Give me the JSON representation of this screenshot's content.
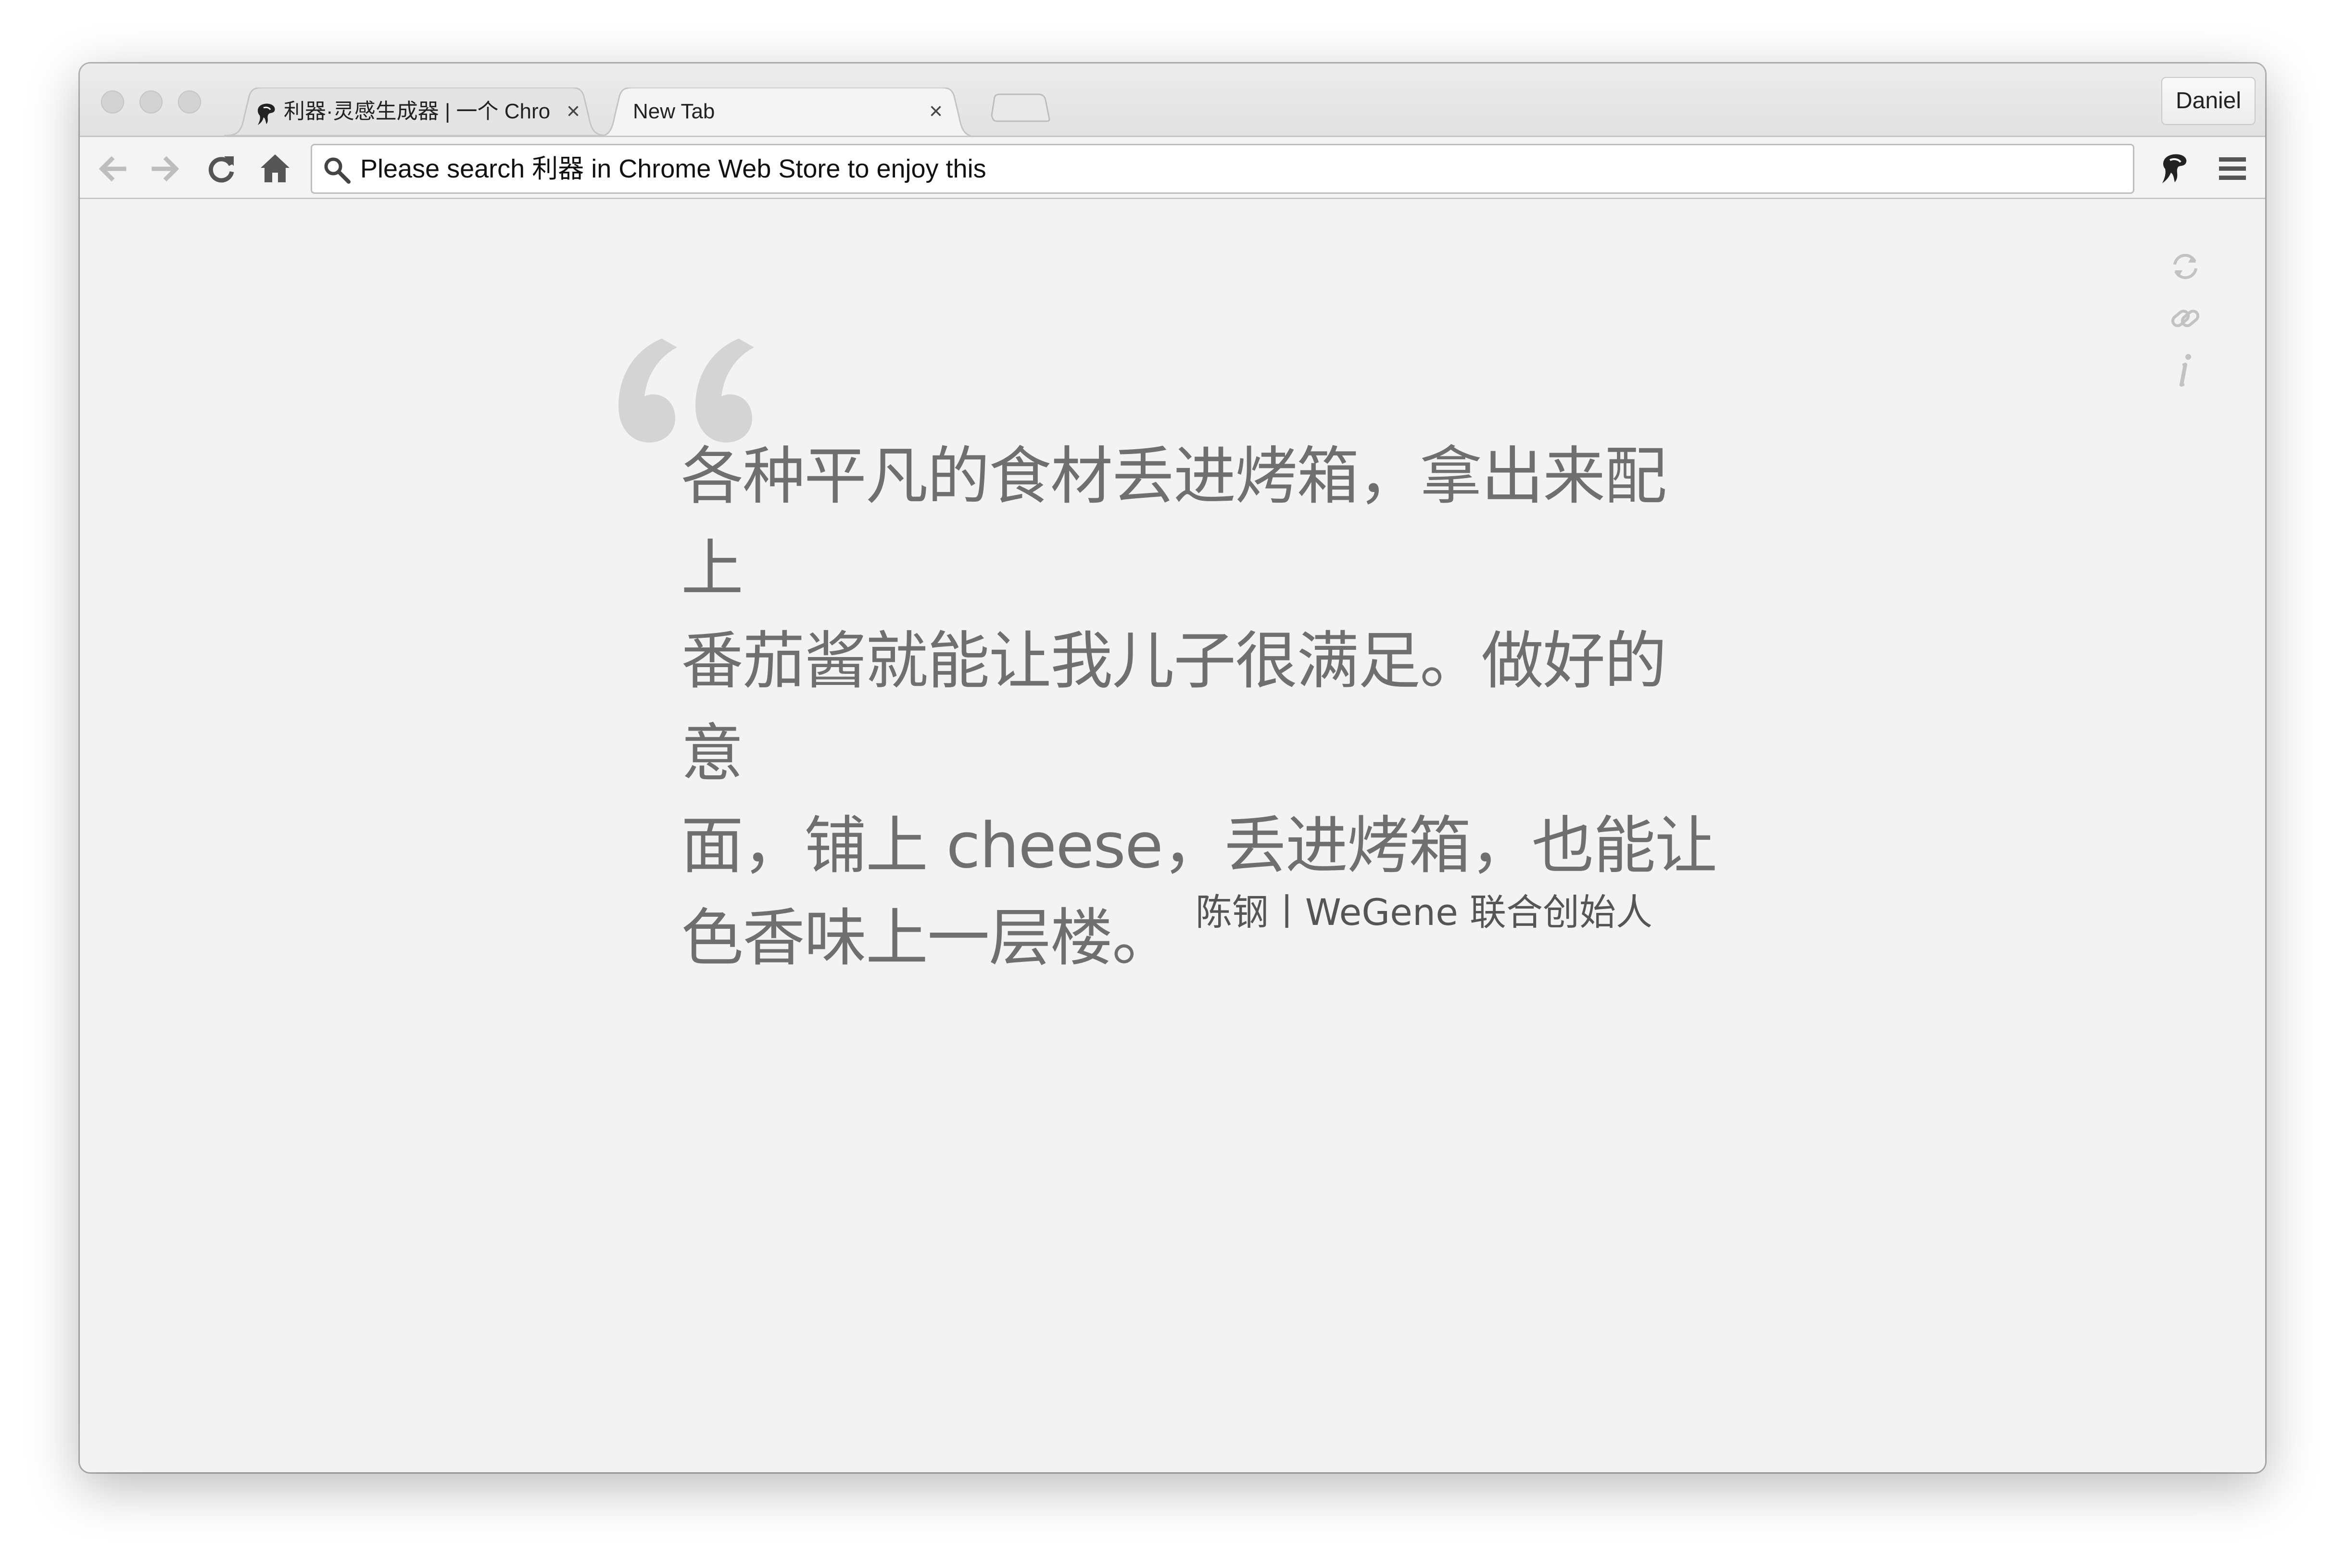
{
  "window": {
    "traffic_lights": [
      "close",
      "minimize",
      "zoom"
    ]
  },
  "tabs": [
    {
      "title": "利器·灵感生成器 | 一个 Chro",
      "icon": "jellyfish-favicon",
      "active": false
    },
    {
      "title": "New Tab",
      "icon": "",
      "active": true
    }
  ],
  "profile": {
    "name": "Daniel"
  },
  "toolbar": {
    "back": "back-arrow-icon",
    "forward": "forward-arrow-icon",
    "reload": "reload-icon",
    "home": "home-icon",
    "extension": "jellyfish-extension-icon",
    "menu": "hamburger-menu-icon"
  },
  "omnibox": {
    "text": "Please search 利器 in Chrome Web Store to enjoy this",
    "icon": "search-icon"
  },
  "side_actions": [
    "refresh-icon",
    "link-icon",
    "info-icon"
  ],
  "quote": {
    "lines": [
      "各种平凡的食材丢进烤箱，拿出来配上",
      "番茄酱就能让我儿子很满足。做好的意",
      "面，铺上 cheese，丢进烤箱，也能让",
      "色香味上一层楼。"
    ],
    "author": "陈钢丨WeGene 联合创始人"
  },
  "colors": {
    "page_background": "#f3f3f3",
    "quote_text": "#6f6f6f",
    "quote_mark": "#d4d4d4",
    "author_text": "#555555"
  }
}
